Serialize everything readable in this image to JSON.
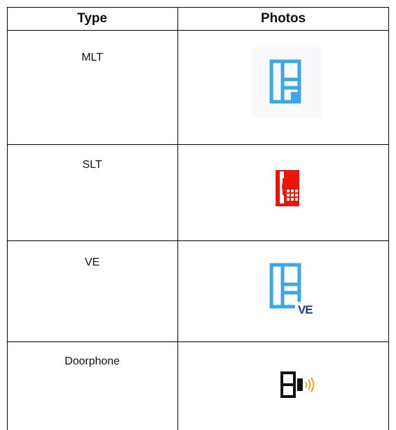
{
  "table": {
    "headers": [
      "Type",
      "Photos"
    ],
    "rows": [
      {
        "type": "MLT",
        "icon": "mlt-phone-icon"
      },
      {
        "type": "SLT",
        "icon": "slt-phone-icon"
      },
      {
        "type": "VE",
        "icon": "ve-phone-icon",
        "badge": "VE"
      },
      {
        "type": "Doorphone",
        "icon": "doorphone-icon"
      }
    ]
  },
  "colors": {
    "mlt": "#3aa7e6",
    "slt": "#e8160c",
    "ve": "#3aa7e6",
    "ve_badge": "#1c3f8f",
    "doorphone": "#111111",
    "doorphone_sound": "#f2a21b"
  }
}
